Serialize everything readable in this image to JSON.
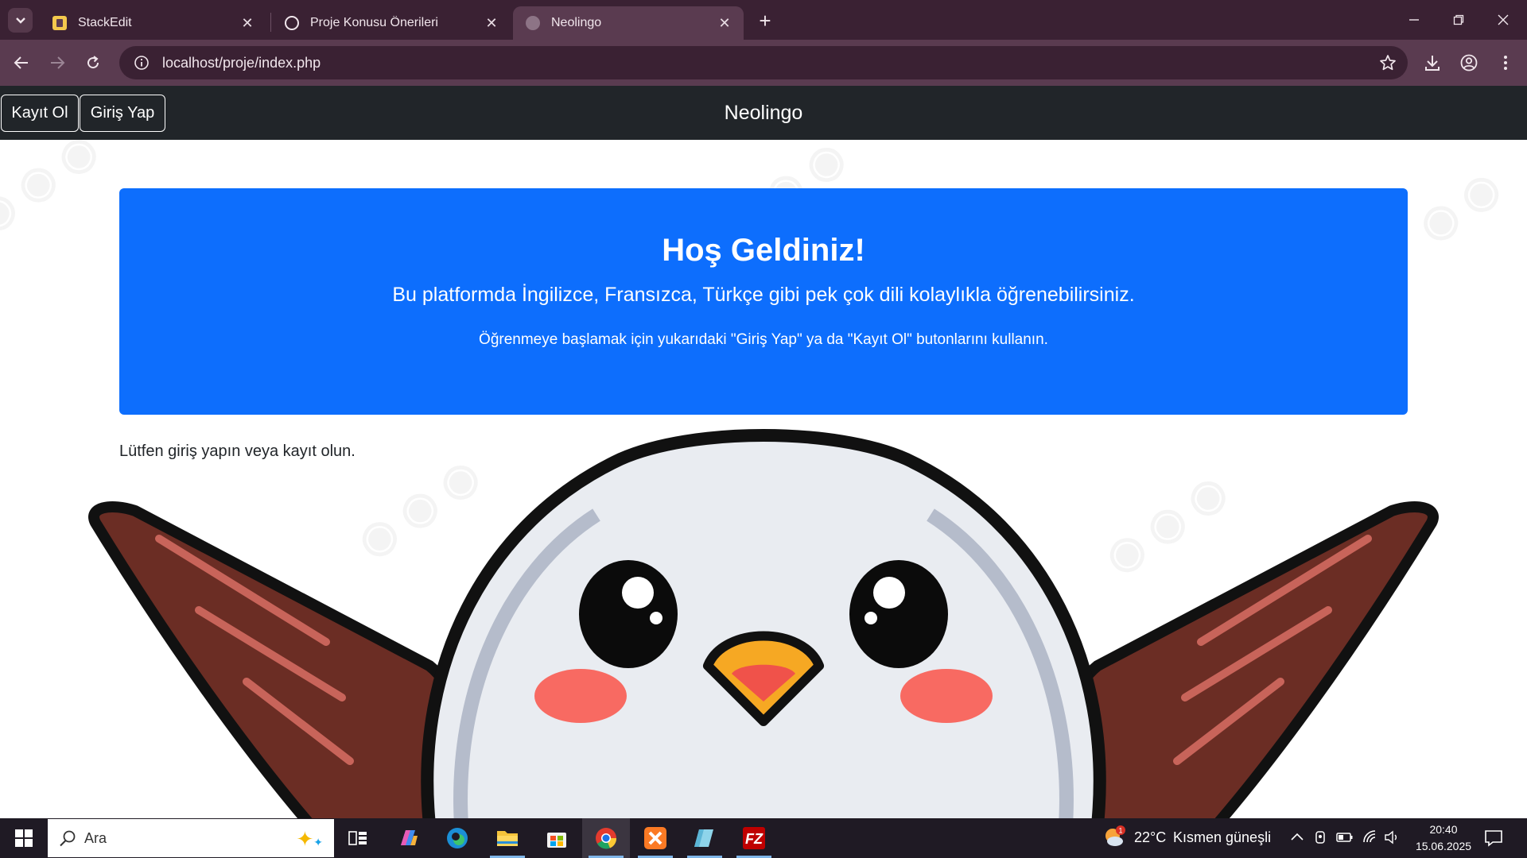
{
  "browser": {
    "tabs": [
      {
        "title": "StackEdit",
        "icon": "stackedit-icon",
        "active": false
      },
      {
        "title": "Proje Konusu Önerileri",
        "icon": "chatgpt-icon",
        "active": false
      },
      {
        "title": "Neolingo",
        "icon": "globe-icon",
        "active": true
      }
    ],
    "url": "localhost/proje/index.php",
    "accent": "#5a3b50"
  },
  "site": {
    "nav": {
      "signup_label": "Kayıt Ol",
      "login_label": "Giriş Yap",
      "brand": "Neolingo"
    },
    "hero": {
      "title": "Hoş Geldiniz!",
      "lead": "Bu platformda İngilizce, Fransızca, Türkçe gibi pek çok dili kolaylıkla öğrenebilirsiniz.",
      "note": "Öğrenmeye başlamak için yukarıdaki \"Giriş Yap\" ya da \"Kayıt Ol\" butonlarını kullanın.",
      "color": "#0d6efd"
    },
    "prompt": "Lütfen giriş yapın veya kayıt olun."
  },
  "taskbar": {
    "search_placeholder": "Ara",
    "apps": [
      "task-view-icon",
      "copilot-icon",
      "edge-icon",
      "file-explorer-icon",
      "store-icon",
      "chrome-icon",
      "xampp-icon",
      "notepad-icon",
      "filezilla-icon"
    ],
    "weather": {
      "temp": "22°C",
      "desc": "Kısmen güneşli",
      "badge": "1"
    },
    "time": "20:40",
    "date": "15.06.2025"
  }
}
